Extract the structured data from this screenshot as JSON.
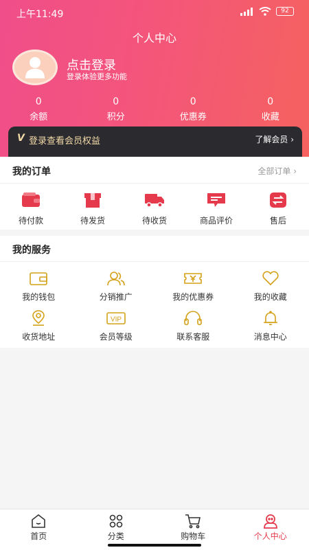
{
  "status_bar": {
    "time": "上午11:49",
    "battery": "92"
  },
  "header": {
    "title": "个人中心",
    "login_title": "点击登录",
    "login_subtitle": "登录体验更多功能",
    "stats": [
      {
        "value": "0",
        "label": "余额"
      },
      {
        "value": "0",
        "label": "积分"
      },
      {
        "value": "0",
        "label": "优惠券"
      },
      {
        "value": "0",
        "label": "收藏"
      }
    ]
  },
  "vip_banner": {
    "badge": "V",
    "text": "登录查看会员权益",
    "more": "了解会员 ›"
  },
  "orders": {
    "title": "我的订单",
    "more": "全部订单 ›",
    "items": [
      {
        "label": "待付款",
        "icon": "wallet-icon"
      },
      {
        "label": "待发货",
        "icon": "box-icon"
      },
      {
        "label": "待收货",
        "icon": "truck-icon"
      },
      {
        "label": "商品评价",
        "icon": "comment-icon"
      },
      {
        "label": "售后",
        "icon": "exchange-icon"
      }
    ]
  },
  "services": {
    "title": "我的服务",
    "items": [
      {
        "label": "我的钱包",
        "icon": "wallet-icon"
      },
      {
        "label": "分销推广",
        "icon": "users-icon"
      },
      {
        "label": "我的优惠券",
        "icon": "coupon-icon"
      },
      {
        "label": "我的收藏",
        "icon": "heart-icon"
      },
      {
        "label": "收货地址",
        "icon": "location-icon"
      },
      {
        "label": "会员等级",
        "icon": "vip-icon"
      },
      {
        "label": "联系客服",
        "icon": "headset-icon"
      },
      {
        "label": "消息中心",
        "icon": "bell-icon"
      }
    ]
  },
  "tabbar": [
    {
      "label": "首页",
      "icon": "home-icon"
    },
    {
      "label": "分类",
      "icon": "grid-icon"
    },
    {
      "label": "购物车",
      "icon": "cart-icon"
    },
    {
      "label": "个人中心",
      "icon": "user-icon",
      "active": true
    }
  ],
  "colors": {
    "accent": "#e53a4c",
    "gold": "#d4a017",
    "vip_text": "#f2d9a8"
  }
}
